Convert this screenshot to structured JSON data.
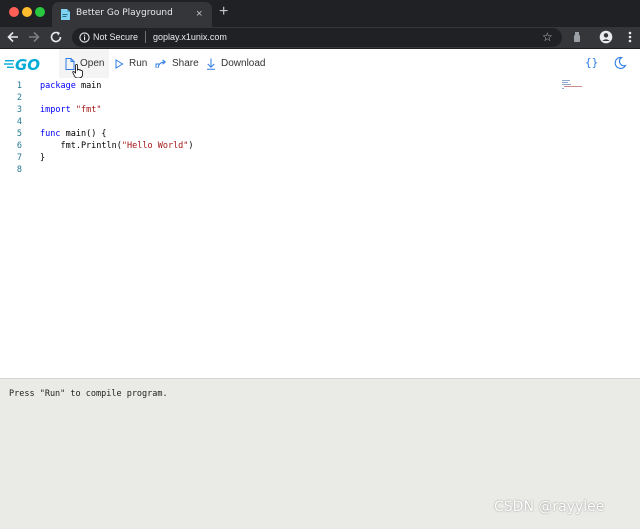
{
  "browser": {
    "tab": {
      "title": "Better Go Playground",
      "close": "×"
    },
    "new_tab": "+",
    "omnibox": {
      "security": "Not Secure",
      "url": "goplay.x1unix.com",
      "star": "☆"
    }
  },
  "header": {
    "buttons": {
      "open": "Open",
      "run": "Run",
      "share": "Share",
      "download": "Download"
    },
    "format_icon": "{}",
    "colors": {
      "accent": "#2c7be5",
      "logo": "#00acd7"
    }
  },
  "editor": {
    "lines": [
      {
        "num": "1",
        "tokens": [
          {
            "t": "package",
            "c": "kw"
          },
          {
            "t": " main",
            "c": ""
          }
        ]
      },
      {
        "num": "2",
        "tokens": []
      },
      {
        "num": "3",
        "tokens": [
          {
            "t": "import",
            "c": "kw"
          },
          {
            "t": " ",
            "c": ""
          },
          {
            "t": "\"fmt\"",
            "c": "str"
          }
        ]
      },
      {
        "num": "4",
        "tokens": []
      },
      {
        "num": "5",
        "tokens": [
          {
            "t": "func",
            "c": "kw"
          },
          {
            "t": " main() {",
            "c": ""
          }
        ]
      },
      {
        "num": "6",
        "tokens": [
          {
            "t": "    fmt.Println(",
            "c": ""
          },
          {
            "t": "\"Hello World\"",
            "c": "str"
          },
          {
            "t": ")",
            "c": ""
          }
        ]
      },
      {
        "num": "7",
        "tokens": [
          {
            "t": "}",
            "c": ""
          }
        ]
      },
      {
        "num": "8",
        "tokens": []
      }
    ]
  },
  "output": {
    "text": "Press \"Run\" to compile program."
  },
  "watermark": "CSDN @rayylee"
}
